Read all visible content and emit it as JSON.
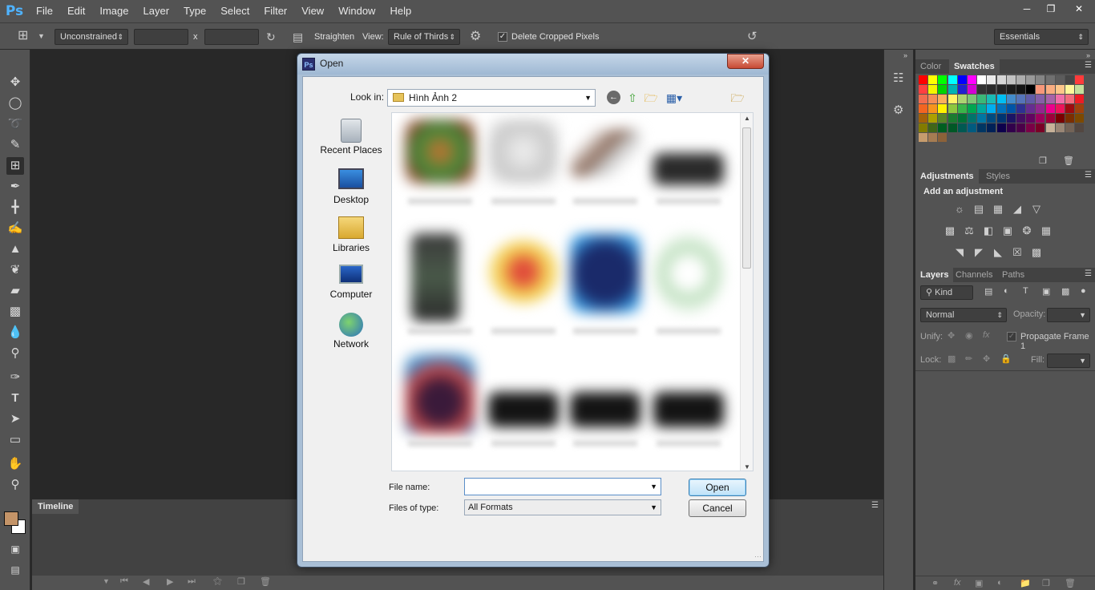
{
  "app": {
    "logo": "Ps",
    "menu": [
      "File",
      "Edit",
      "Image",
      "Layer",
      "Type",
      "Select",
      "Filter",
      "View",
      "Window",
      "Help"
    ],
    "window_controls": [
      "minimize-icon",
      "restore-icon",
      "close-icon"
    ]
  },
  "options_bar": {
    "ratio": "Unconstrained",
    "width_value": "",
    "height_value": "",
    "x_separator": "x",
    "straighten_label": "Straighten",
    "view_label": "View:",
    "view_value": "Rule of Thirds",
    "delete_cropped_label": "Delete Cropped Pixels",
    "delete_cropped_checked": true,
    "workspace": "Essentials"
  },
  "timeline": {
    "tab_label": "Timeline"
  },
  "panels": {
    "color_tabs": [
      "Color",
      "Swatches"
    ],
    "adjustments_tabs": [
      "Adjustments",
      "Styles"
    ],
    "adjustments_heading": "Add an adjustment",
    "layers_tabs": [
      "Layers",
      "Channels",
      "Paths"
    ],
    "kind_filter": "Kind",
    "blend_mode": "Normal",
    "opacity_label": "Opacity:",
    "opacity_value": "",
    "unify_label": "Unify:",
    "propagate_label": "Propagate Frame 1",
    "lock_label": "Lock:",
    "fill_label": "Fill:",
    "fill_value": "",
    "foreground_color": "#c49468",
    "background_color": "#ffffff"
  },
  "dialog": {
    "title": "Open",
    "icon_text": "Ps",
    "look_in_label": "Look in:",
    "look_in_value": "Hình Ảnh 2",
    "places": [
      "Recent Places",
      "Desktop",
      "Libraries",
      "Computer",
      "Network"
    ],
    "file_name_label": "File name:",
    "file_name_value": "",
    "files_of_type_label": "Files of type:",
    "files_of_type_value": "All Formats",
    "open_button": "Open",
    "cancel_button": "Cancel"
  }
}
